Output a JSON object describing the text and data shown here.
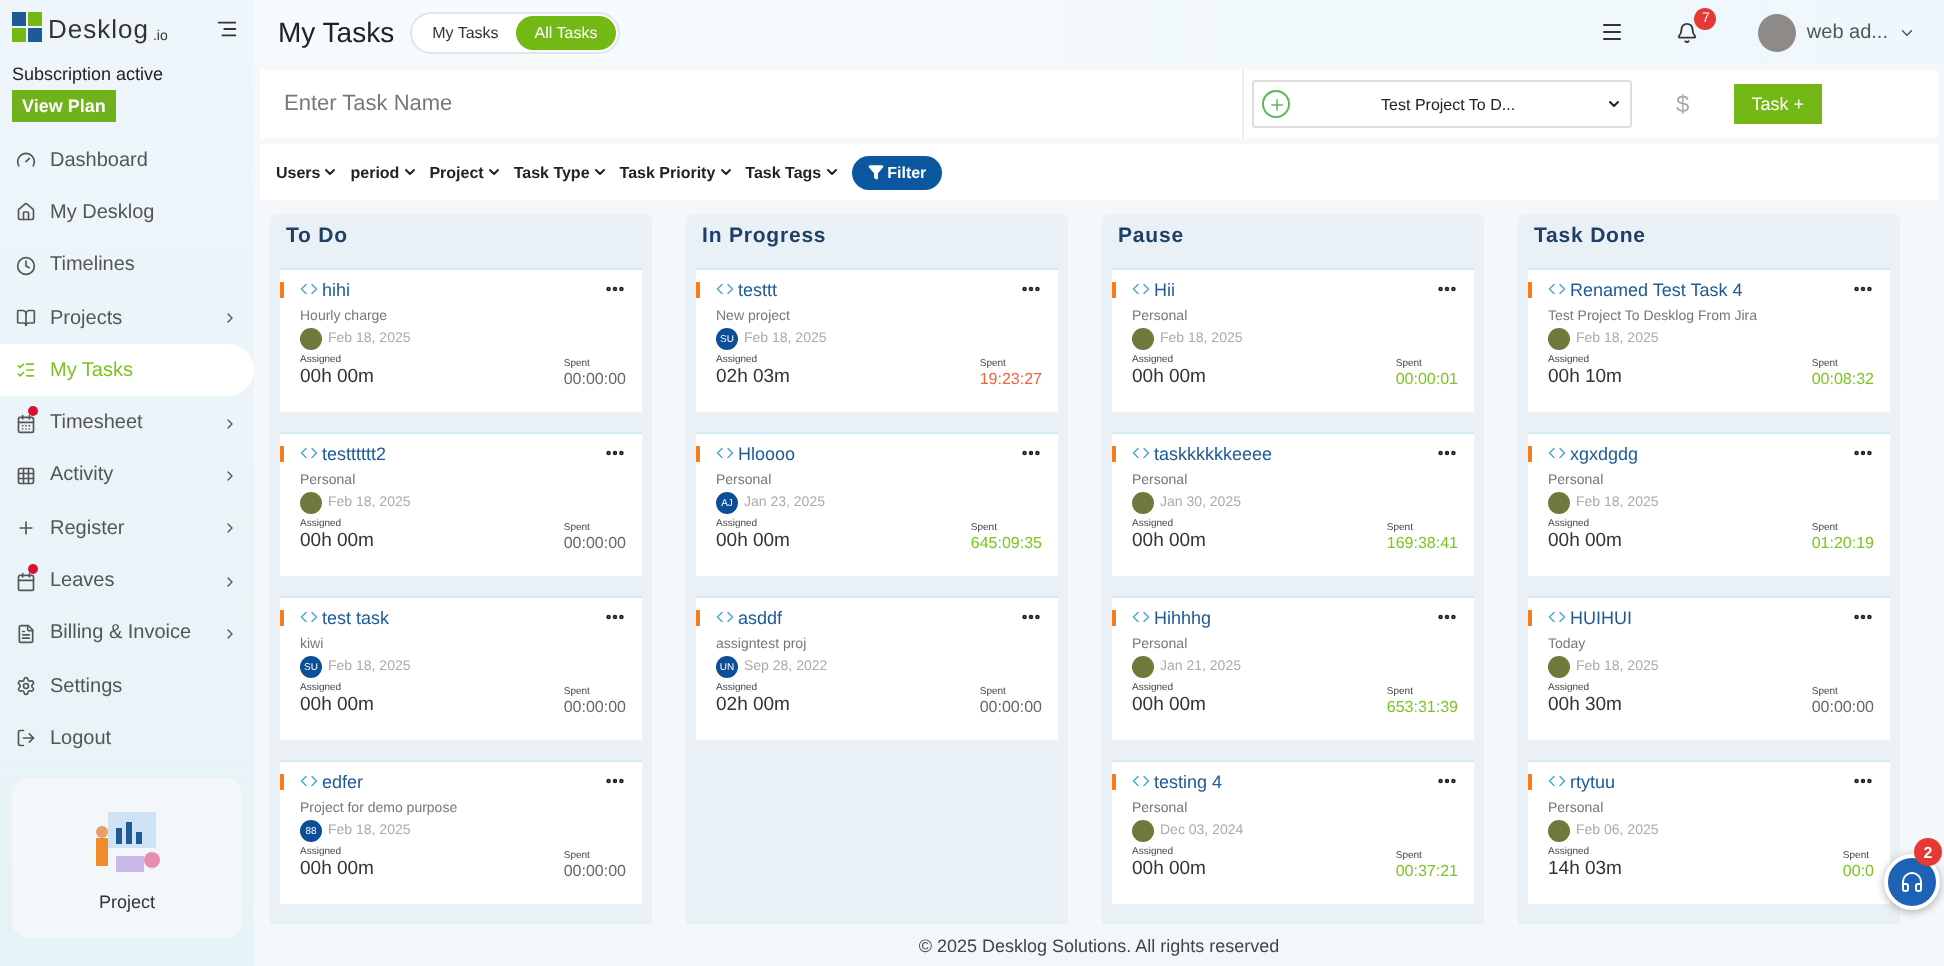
{
  "brand": {
    "name": "Desklog",
    "suffix": ".io"
  },
  "subscription": {
    "status": "Subscription active",
    "button": "View Plan"
  },
  "sidebar": {
    "items": [
      {
        "label": "Dashboard",
        "selected": false,
        "submenu": false,
        "dot": false
      },
      {
        "label": "My Desklog",
        "selected": false,
        "submenu": false,
        "dot": false
      },
      {
        "label": "Timelines",
        "selected": false,
        "submenu": false,
        "dot": false
      },
      {
        "label": "Projects",
        "selected": false,
        "submenu": true,
        "dot": false
      },
      {
        "label": "My Tasks",
        "selected": true,
        "submenu": false,
        "dot": false
      },
      {
        "label": "Timesheet",
        "selected": false,
        "submenu": true,
        "dot": true
      },
      {
        "label": "Activity",
        "selected": false,
        "submenu": true,
        "dot": false
      },
      {
        "label": "Register",
        "selected": false,
        "submenu": true,
        "dot": false
      },
      {
        "label": "Leaves",
        "selected": false,
        "submenu": true,
        "dot": true
      },
      {
        "label": "Billing & Invoice",
        "selected": false,
        "submenu": true,
        "dot": false
      },
      {
        "label": "Settings",
        "selected": false,
        "submenu": false,
        "dot": false
      },
      {
        "label": "Logout",
        "selected": false,
        "submenu": false,
        "dot": false
      }
    ],
    "promo": {
      "label": "Project"
    }
  },
  "header": {
    "title": "My Tasks",
    "toggle": [
      {
        "label": "My Tasks",
        "selected": false
      },
      {
        "label": "All Tasks",
        "selected": true
      }
    ],
    "notifications": "7",
    "user": "web ad..."
  },
  "task_entry": {
    "placeholder": "Enter Task Name",
    "project": "Test Project To D...",
    "currency": "$",
    "button": "Task +"
  },
  "filters": {
    "items": [
      "Users",
      "period",
      "Project",
      "Task Type",
      "Task Priority",
      "Task Tags"
    ],
    "button": "Filter"
  },
  "columns": [
    {
      "title": "To Do",
      "cards": [
        {
          "title": "hihi",
          "project": "Hourly charge",
          "avatar": {
            "kind": "photo"
          },
          "date": "Feb 18, 2025",
          "assigned_label": "Assigned",
          "assigned": "00h 00m",
          "spent_label": "Spent",
          "spent": "00:00:00",
          "color": "#666666"
        },
        {
          "title": "testttttt2",
          "project": "Personal",
          "avatar": {
            "kind": "photo"
          },
          "date": "Feb 18, 2025",
          "assigned_label": "Assigned",
          "assigned": "00h 00m",
          "spent_label": "Spent",
          "spent": "00:00:00",
          "color": "#666666"
        },
        {
          "title": "test task",
          "project": "kiwi",
          "avatar": {
            "kind": "initials",
            "text": "SU"
          },
          "date": "Feb 18, 2025",
          "assigned_label": "Assigned",
          "assigned": "00h 00m",
          "spent_label": "Spent",
          "spent": "00:00:00",
          "color": "#666666"
        },
        {
          "title": "edfer",
          "project": "Project for demo purpose",
          "avatar": {
            "kind": "initials",
            "text": "88"
          },
          "date": "Feb 18, 2025",
          "assigned_label": "Assigned",
          "assigned": "00h 00m",
          "spent_label": "Spent",
          "spent": "00:00:00",
          "color": "#666666"
        }
      ]
    },
    {
      "title": "In Progress",
      "cards": [
        {
          "title": "testtt",
          "project": "New project",
          "avatar": {
            "kind": "initials",
            "text": "SU"
          },
          "date": "Feb 18, 2025",
          "assigned_label": "Assigned",
          "assigned": "02h 03m",
          "spent_label": "Spent",
          "spent": "19:23:27",
          "color": "#f0643c"
        },
        {
          "title": "Hloooo",
          "project": "Personal",
          "avatar": {
            "kind": "initials",
            "text": "AJ"
          },
          "date": "Jan 23, 2025",
          "assigned_label": "Assigned",
          "assigned": "00h 00m",
          "spent_label": "Spent",
          "spent": "645:09:35",
          "color": "#7cc41e"
        },
        {
          "title": "asddf",
          "project": "assigntest proj",
          "avatar": {
            "kind": "initials",
            "text": "UN"
          },
          "date": "Sep 28, 2022",
          "assigned_label": "Assigned",
          "assigned": "02h 00m",
          "spent_label": "Spent",
          "spent": "00:00:00",
          "color": "#666666"
        }
      ]
    },
    {
      "title": "Pause",
      "cards": [
        {
          "title": "Hii",
          "project": "Personal",
          "avatar": {
            "kind": "photo"
          },
          "date": "Feb 18, 2025",
          "assigned_label": "Assigned",
          "assigned": "00h 00m",
          "spent_label": "Spent",
          "spent": "00:00:01",
          "color": "#7cc41e"
        },
        {
          "title": "taskkkkkkeeee",
          "project": "Personal",
          "avatar": {
            "kind": "photo"
          },
          "date": "Jan 30, 2025",
          "assigned_label": "Assigned",
          "assigned": "00h 00m",
          "spent_label": "Spent",
          "spent": "169:38:41",
          "color": "#7cc41e"
        },
        {
          "title": "Hihhhg",
          "project": "Personal",
          "avatar": {
            "kind": "photo"
          },
          "date": "Jan 21, 2025",
          "assigned_label": "Assigned",
          "assigned": "00h 00m",
          "spent_label": "Spent",
          "spent": "653:31:39",
          "color": "#7cc41e"
        },
        {
          "title": "testing 4",
          "project": "Personal",
          "avatar": {
            "kind": "photo"
          },
          "date": "Dec 03, 2024",
          "assigned_label": "Assigned",
          "assigned": "00h 00m",
          "spent_label": "Spent",
          "spent": "00:37:21",
          "color": "#7cc41e"
        }
      ]
    },
    {
      "title": "Task Done",
      "cards": [
        {
          "title": "Renamed Test Task 4",
          "project": "Test Project To Desklog From Jira",
          "avatar": {
            "kind": "photo"
          },
          "date": "Feb 18, 2025",
          "assigned_label": "Assigned",
          "assigned": "00h 10m",
          "spent_label": "Spent",
          "spent": "00:08:32",
          "color": "#7cc41e"
        },
        {
          "title": "xgxdgdg",
          "project": "Personal",
          "avatar": {
            "kind": "photo"
          },
          "date": "Feb 18, 2025",
          "assigned_label": "Assigned",
          "assigned": "00h 00m",
          "spent_label": "Spent",
          "spent": "01:20:19",
          "color": "#7cc41e"
        },
        {
          "title": "HUIHUI",
          "project": "Today",
          "avatar": {
            "kind": "photo"
          },
          "date": "Feb 18, 2025",
          "assigned_label": "Assigned",
          "assigned": "00h 30m",
          "spent_label": "Spent",
          "spent": "00:00:00",
          "color": "#666666"
        },
        {
          "title": "rtytuu",
          "project": "Personal",
          "avatar": {
            "kind": "photo"
          },
          "date": "Feb 06, 2025",
          "assigned_label": "Assigned",
          "assigned": "14h 03m",
          "spent_label": "Spent",
          "spent": "00:0",
          "color": "#7cc41e"
        }
      ]
    }
  ],
  "chat": {
    "badge": "2"
  },
  "footer": "© 2025 Desklog Solutions. All rights reserved"
}
